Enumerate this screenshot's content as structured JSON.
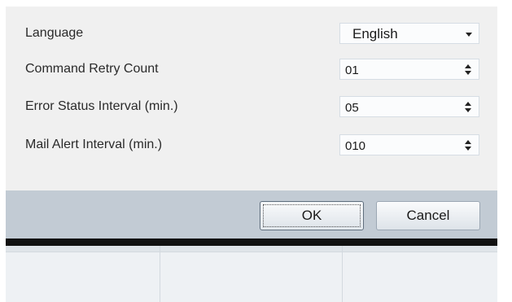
{
  "settings": {
    "language_label": "Language",
    "language_value": "English",
    "retry_label": "Command Retry Count",
    "retry_value": "01",
    "error_interval_label": "Error Status Interval (min.)",
    "error_interval_value": "05",
    "mail_interval_label": "Mail Alert Interval (min.)",
    "mail_interval_value": "010"
  },
  "buttons": {
    "ok_label": "OK",
    "cancel_label": "Cancel"
  },
  "icons": {
    "dropdown": "chevron-down-icon",
    "spin": "spin-arrows-icon"
  }
}
